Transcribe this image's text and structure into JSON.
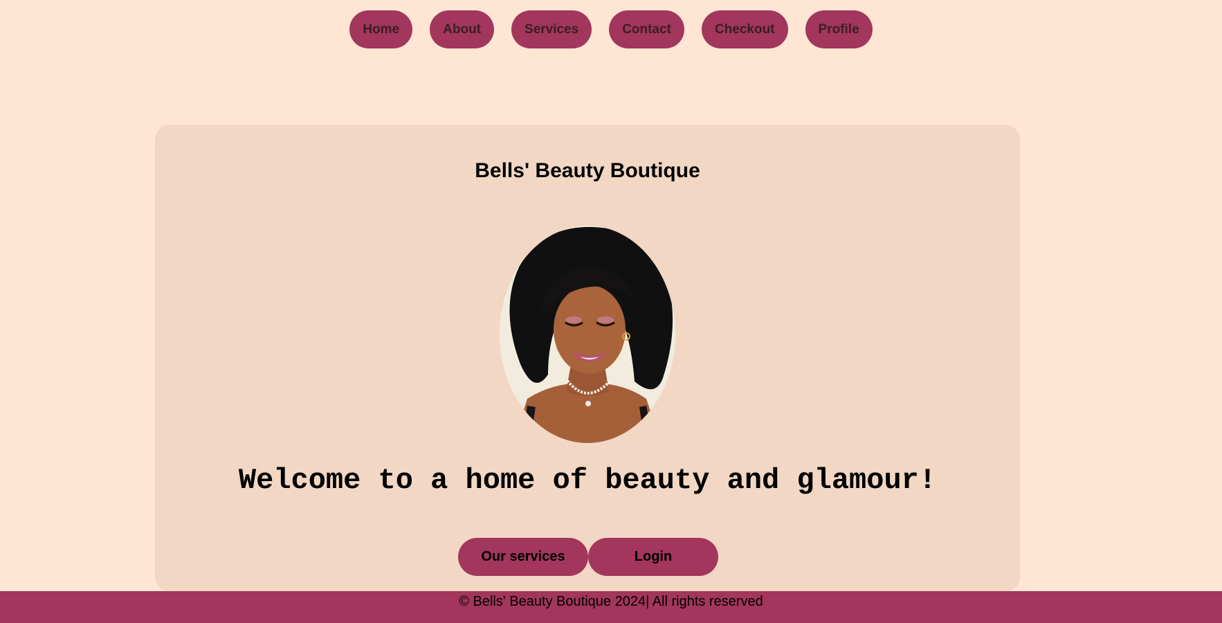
{
  "nav": {
    "items": [
      {
        "label": "Home"
      },
      {
        "label": "About"
      },
      {
        "label": "Services"
      },
      {
        "label": "Contact"
      },
      {
        "label": "Checkout"
      },
      {
        "label": "Profile"
      }
    ]
  },
  "hero": {
    "title": "Bells' Beauty Boutique",
    "image_icon": "portrait-photo",
    "welcome": "Welcome to a home of beauty and glamour!",
    "buttons": {
      "services": "Our services",
      "login": "Login"
    }
  },
  "footer": {
    "text": "© Bells' Beauty Boutique 2024| All rights reserved"
  },
  "colors": {
    "page_bg": "#ffe6d4",
    "card_bg": "#f2d7c4",
    "accent": "#a2365c",
    "nav_text": "#3a1e28"
  }
}
